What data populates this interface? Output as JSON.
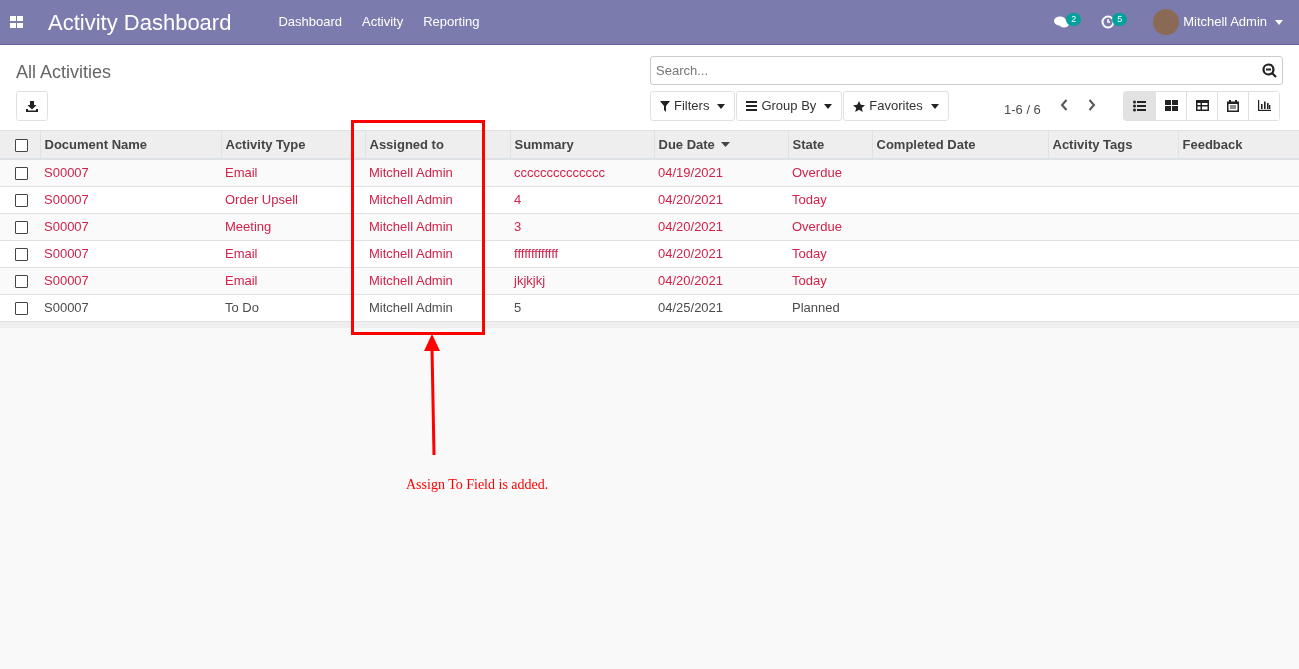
{
  "navbar": {
    "app_title": "Activity Dashboard",
    "menu": [
      "Dashboard",
      "Activity",
      "Reporting"
    ],
    "messages_count": "2",
    "activities_count": "5",
    "user": "Mitchell Admin"
  },
  "control_panel": {
    "title": "All Activities",
    "search": {
      "placeholder": "Search..."
    },
    "filters": [
      "Filters",
      "Group By",
      "Favorites"
    ],
    "pager": "1-6 / 6",
    "views": [
      {
        "kind": "list",
        "selected": true
      },
      {
        "kind": "kanban",
        "selected": false
      },
      {
        "kind": "pivot",
        "selected": false
      },
      {
        "kind": "calendar",
        "selected": false
      },
      {
        "kind": "graph",
        "selected": false
      }
    ]
  },
  "table": {
    "select_all_checked": false,
    "columns": [
      {
        "label": "Document Name",
        "sorted": false
      },
      {
        "label": "Activity Type",
        "sorted": false
      },
      {
        "label": "Assigned to",
        "sorted": false
      },
      {
        "label": "Summary",
        "sorted": false
      },
      {
        "label": "Due Date",
        "sorted": true
      },
      {
        "label": "State",
        "sorted": false
      },
      {
        "label": "Completed Date",
        "sorted": false
      },
      {
        "label": "Activity Tags",
        "sorted": false
      },
      {
        "label": "Feedback",
        "sorted": false
      }
    ],
    "rows": [
      {
        "checked": false,
        "late": true,
        "cells": [
          "S00007",
          "Email",
          "Mitchell Admin",
          "cccccccccccccc",
          "04/19/2021",
          "Overdue"
        ]
      },
      {
        "checked": false,
        "late": true,
        "cells": [
          "S00007",
          "Order Upsell",
          "Mitchell Admin",
          "4",
          "04/20/2021",
          "Today"
        ]
      },
      {
        "checked": false,
        "late": true,
        "cells": [
          "S00007",
          "Meeting",
          "Mitchell Admin",
          "3",
          "04/20/2021",
          "Overdue"
        ]
      },
      {
        "checked": false,
        "late": true,
        "cells": [
          "S00007",
          "Email",
          "Mitchell Admin",
          "fffffffffffff",
          "04/20/2021",
          "Today"
        ]
      },
      {
        "checked": false,
        "late": true,
        "cells": [
          "S00007",
          "Email",
          "Mitchell Admin",
          "jkjkjkj",
          "04/20/2021",
          "Today"
        ]
      },
      {
        "checked": false,
        "late": false,
        "cells": [
          "S00007",
          "To Do",
          "Mitchell Admin",
          "5",
          "04/25/2021",
          "Planned"
        ]
      }
    ]
  },
  "annotation": {
    "note": "Assign To Field is added."
  }
}
